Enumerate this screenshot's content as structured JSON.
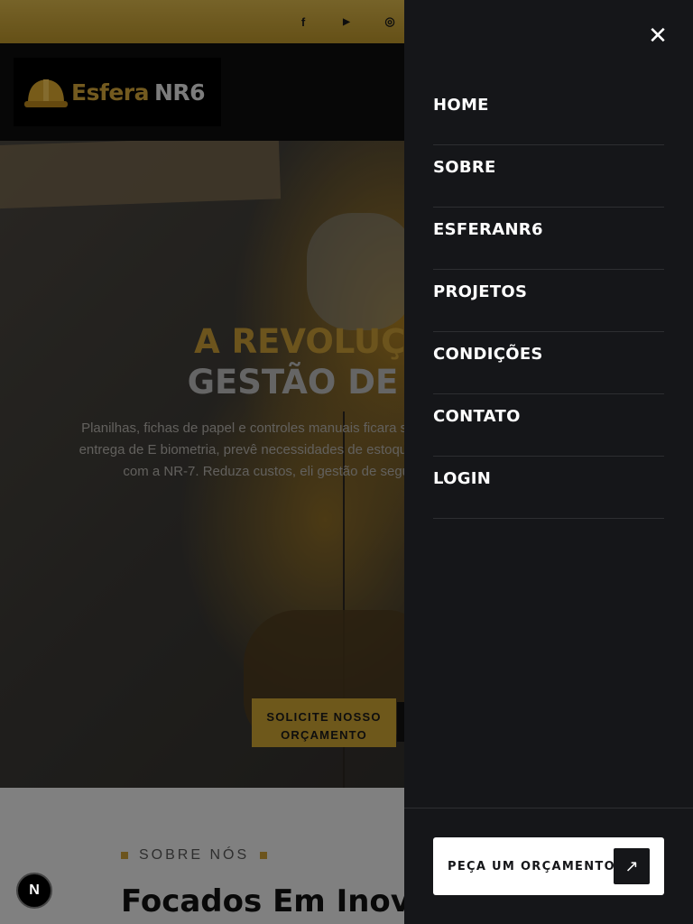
{
  "topbar": {
    "social": [
      {
        "name": "facebook-icon",
        "glyph": "f"
      },
      {
        "name": "youtube-icon",
        "glyph": "▶"
      },
      {
        "name": "instagram-icon",
        "glyph": "◎"
      }
    ]
  },
  "header": {
    "logo_part1": "Esfera",
    "logo_part2": "NR6"
  },
  "hero": {
    "title_line1": "A REVOLUÇÃO D",
    "title_line2": "GESTÃO DE EPI C",
    "text": "Planilhas, fichas de papel e controles manuais ficara sistema inteligente que centraliza a entrega de E biometria, prevê necessidades de estoque com IA e c NR-6 e indiretamente com a NR-7. Reduza custos, eli gestão de segurança moderna, eficiente e",
    "cta_label": "SOLICITE NOSSO ORÇAMENTO"
  },
  "about": {
    "tag": "SOBRE NÓS",
    "title": "Focados Em Inova"
  },
  "drawer": {
    "close_glyph": "✕",
    "menu": [
      "HOME",
      "SOBRE",
      "ESFERANR6",
      "PROJETOS",
      "CONDIÇÕES",
      "CONTATO",
      "LOGIN"
    ],
    "quote_label": "PEÇA UM ORÇAMENTO",
    "quote_arrow": "↗"
  },
  "dev_badge": "N",
  "colors": {
    "accent": "#c9a032",
    "drawer_bg": "#151619",
    "topbar": "#d7b44a"
  }
}
